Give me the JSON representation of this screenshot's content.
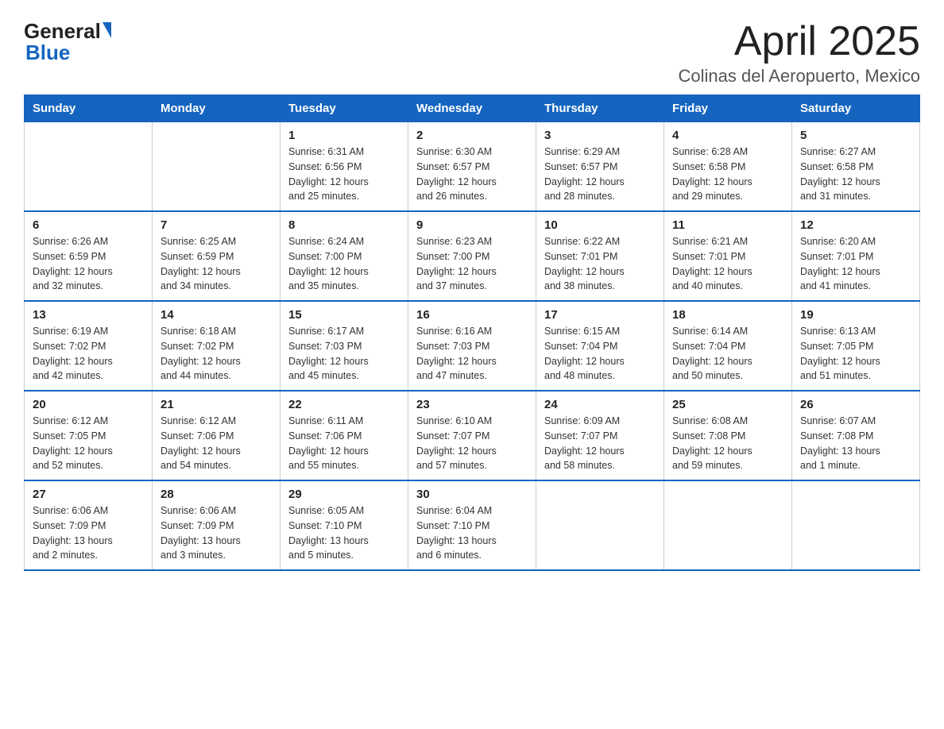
{
  "header": {
    "logo_general": "General",
    "logo_blue": "Blue",
    "title": "April 2025",
    "subtitle": "Colinas del Aeropuerto, Mexico"
  },
  "calendar": {
    "days_of_week": [
      "Sunday",
      "Monday",
      "Tuesday",
      "Wednesday",
      "Thursday",
      "Friday",
      "Saturday"
    ],
    "weeks": [
      [
        {
          "day": "",
          "info": ""
        },
        {
          "day": "",
          "info": ""
        },
        {
          "day": "1",
          "info": "Sunrise: 6:31 AM\nSunset: 6:56 PM\nDaylight: 12 hours\nand 25 minutes."
        },
        {
          "day": "2",
          "info": "Sunrise: 6:30 AM\nSunset: 6:57 PM\nDaylight: 12 hours\nand 26 minutes."
        },
        {
          "day": "3",
          "info": "Sunrise: 6:29 AM\nSunset: 6:57 PM\nDaylight: 12 hours\nand 28 minutes."
        },
        {
          "day": "4",
          "info": "Sunrise: 6:28 AM\nSunset: 6:58 PM\nDaylight: 12 hours\nand 29 minutes."
        },
        {
          "day": "5",
          "info": "Sunrise: 6:27 AM\nSunset: 6:58 PM\nDaylight: 12 hours\nand 31 minutes."
        }
      ],
      [
        {
          "day": "6",
          "info": "Sunrise: 6:26 AM\nSunset: 6:59 PM\nDaylight: 12 hours\nand 32 minutes."
        },
        {
          "day": "7",
          "info": "Sunrise: 6:25 AM\nSunset: 6:59 PM\nDaylight: 12 hours\nand 34 minutes."
        },
        {
          "day": "8",
          "info": "Sunrise: 6:24 AM\nSunset: 7:00 PM\nDaylight: 12 hours\nand 35 minutes."
        },
        {
          "day": "9",
          "info": "Sunrise: 6:23 AM\nSunset: 7:00 PM\nDaylight: 12 hours\nand 37 minutes."
        },
        {
          "day": "10",
          "info": "Sunrise: 6:22 AM\nSunset: 7:01 PM\nDaylight: 12 hours\nand 38 minutes."
        },
        {
          "day": "11",
          "info": "Sunrise: 6:21 AM\nSunset: 7:01 PM\nDaylight: 12 hours\nand 40 minutes."
        },
        {
          "day": "12",
          "info": "Sunrise: 6:20 AM\nSunset: 7:01 PM\nDaylight: 12 hours\nand 41 minutes."
        }
      ],
      [
        {
          "day": "13",
          "info": "Sunrise: 6:19 AM\nSunset: 7:02 PM\nDaylight: 12 hours\nand 42 minutes."
        },
        {
          "day": "14",
          "info": "Sunrise: 6:18 AM\nSunset: 7:02 PM\nDaylight: 12 hours\nand 44 minutes."
        },
        {
          "day": "15",
          "info": "Sunrise: 6:17 AM\nSunset: 7:03 PM\nDaylight: 12 hours\nand 45 minutes."
        },
        {
          "day": "16",
          "info": "Sunrise: 6:16 AM\nSunset: 7:03 PM\nDaylight: 12 hours\nand 47 minutes."
        },
        {
          "day": "17",
          "info": "Sunrise: 6:15 AM\nSunset: 7:04 PM\nDaylight: 12 hours\nand 48 minutes."
        },
        {
          "day": "18",
          "info": "Sunrise: 6:14 AM\nSunset: 7:04 PM\nDaylight: 12 hours\nand 50 minutes."
        },
        {
          "day": "19",
          "info": "Sunrise: 6:13 AM\nSunset: 7:05 PM\nDaylight: 12 hours\nand 51 minutes."
        }
      ],
      [
        {
          "day": "20",
          "info": "Sunrise: 6:12 AM\nSunset: 7:05 PM\nDaylight: 12 hours\nand 52 minutes."
        },
        {
          "day": "21",
          "info": "Sunrise: 6:12 AM\nSunset: 7:06 PM\nDaylight: 12 hours\nand 54 minutes."
        },
        {
          "day": "22",
          "info": "Sunrise: 6:11 AM\nSunset: 7:06 PM\nDaylight: 12 hours\nand 55 minutes."
        },
        {
          "day": "23",
          "info": "Sunrise: 6:10 AM\nSunset: 7:07 PM\nDaylight: 12 hours\nand 57 minutes."
        },
        {
          "day": "24",
          "info": "Sunrise: 6:09 AM\nSunset: 7:07 PM\nDaylight: 12 hours\nand 58 minutes."
        },
        {
          "day": "25",
          "info": "Sunrise: 6:08 AM\nSunset: 7:08 PM\nDaylight: 12 hours\nand 59 minutes."
        },
        {
          "day": "26",
          "info": "Sunrise: 6:07 AM\nSunset: 7:08 PM\nDaylight: 13 hours\nand 1 minute."
        }
      ],
      [
        {
          "day": "27",
          "info": "Sunrise: 6:06 AM\nSunset: 7:09 PM\nDaylight: 13 hours\nand 2 minutes."
        },
        {
          "day": "28",
          "info": "Sunrise: 6:06 AM\nSunset: 7:09 PM\nDaylight: 13 hours\nand 3 minutes."
        },
        {
          "day": "29",
          "info": "Sunrise: 6:05 AM\nSunset: 7:10 PM\nDaylight: 13 hours\nand 5 minutes."
        },
        {
          "day": "30",
          "info": "Sunrise: 6:04 AM\nSunset: 7:10 PM\nDaylight: 13 hours\nand 6 minutes."
        },
        {
          "day": "",
          "info": ""
        },
        {
          "day": "",
          "info": ""
        },
        {
          "day": "",
          "info": ""
        }
      ]
    ]
  }
}
